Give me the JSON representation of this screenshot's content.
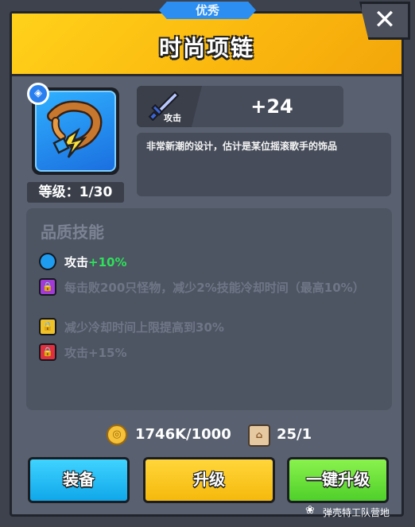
{
  "rarity_label": "优秀",
  "item": {
    "name": "时尚项链",
    "level_label": "等级：1/30",
    "icon": "necklace-icon",
    "badge_icon": "rarity-badge-icon"
  },
  "stat": {
    "icon": "sword-icon",
    "label": "攻击",
    "value": "+24"
  },
  "description": "非常新潮的设计，估计是某位摇滚歌手的饰品",
  "skills": {
    "title": "品质技能",
    "items": [
      {
        "icon": "blue-circle-icon",
        "color": "#1e9cf0",
        "locked": false,
        "text": "攻击",
        "bonus": "+10%"
      },
      {
        "icon": "lock-icon",
        "color": "#a23ad8",
        "locked": true,
        "text": "每击败200只怪物，减少2%技能冷却时间（最高10%）"
      },
      {
        "icon": "lock-icon",
        "color": "#f0c22a",
        "locked": true,
        "text": "减少冷却时间上限提高到30%"
      },
      {
        "icon": "lock-icon",
        "color": "#e03040",
        "locked": true,
        "text": "攻击+15%"
      }
    ]
  },
  "costs": {
    "coins": "1746K/1000",
    "scrolls": "25/1"
  },
  "buttons": {
    "equip": "装备",
    "upgrade": "升级",
    "one_click_upgrade": "一键升级"
  },
  "close_label": "✕",
  "watermark": "弹壳特工队营地",
  "colors": {
    "header": "#fbb90f",
    "panel": "#596170",
    "equip_button": "#10a7ea",
    "upgrade_button": "#f6b90c",
    "one_click_button": "#4fcf2a",
    "rarity": "#2d8ef2"
  }
}
